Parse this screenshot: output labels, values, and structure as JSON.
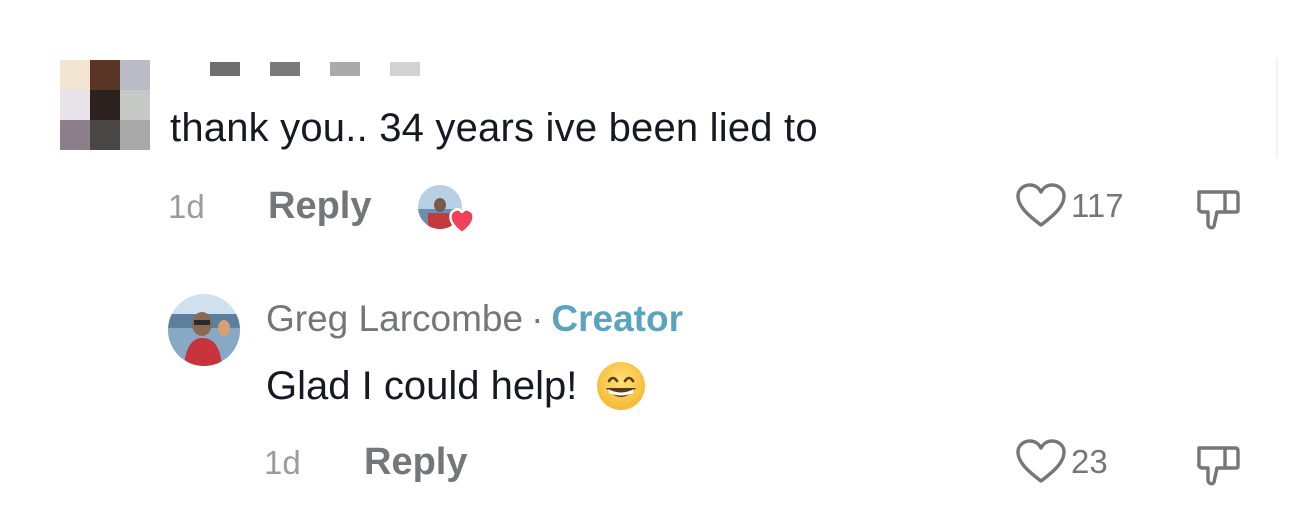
{
  "comment": {
    "text": "thank you.. 34 years ive been lied to",
    "time": "1d",
    "reply_label": "Reply",
    "like_count": "117",
    "avatar_colors": [
      "#f2e6d2",
      "#5a3424",
      "#b9bcc4",
      "#e9e3ea",
      "#2b2220",
      "#c7c9c7",
      "#8c7f8c",
      "#4a4644",
      "#a8a9a8"
    ],
    "creator_liked": true
  },
  "reply": {
    "author": "Greg Larcombe",
    "separator": "·",
    "badge": "Creator",
    "text": "Glad I could help!",
    "emoji": "grinning-face-with-smiling-eyes",
    "time": "1d",
    "reply_label": "Reply",
    "like_count": "23"
  },
  "colors": {
    "creator_accent": "#5aa4bf",
    "heart_red": "#f0405a",
    "muted_text": "#75767a"
  }
}
